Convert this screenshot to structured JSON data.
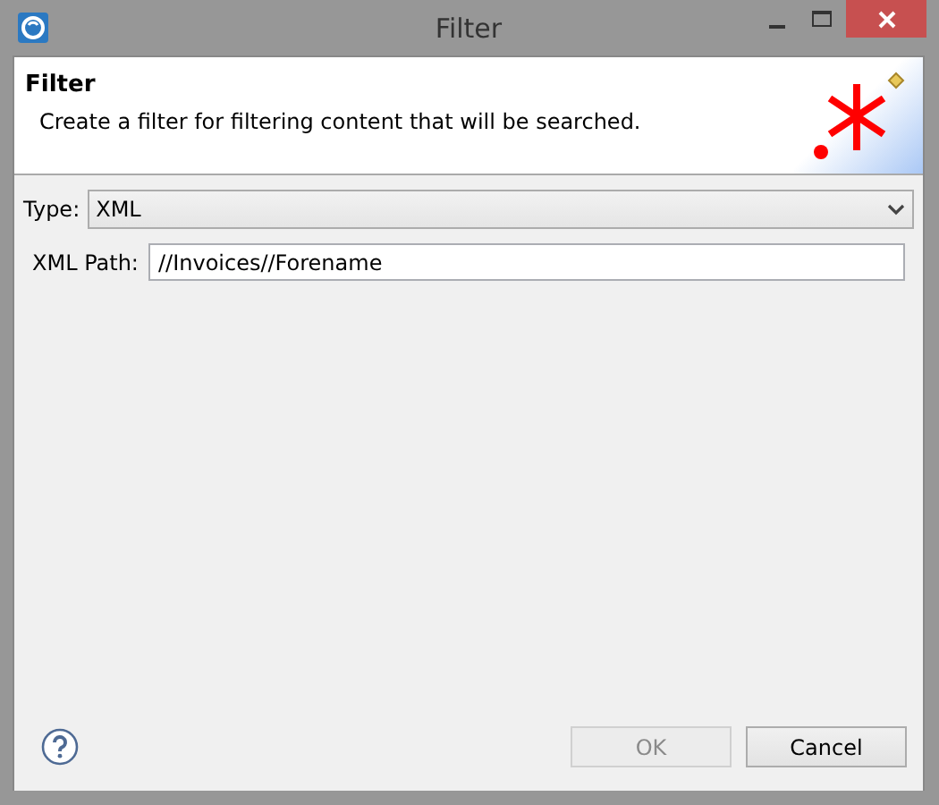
{
  "window": {
    "title": "Filter"
  },
  "header": {
    "title": "Filter",
    "description": "Create a filter for filtering content that will be searched."
  },
  "fields": [
    {
      "kind": "dropdown",
      "label": "Type:",
      "value": "XML"
    },
    {
      "kind": "text",
      "label": "XML Path:",
      "value": "//Invoices//Forename"
    }
  ],
  "buttons": [
    {
      "label": "OK",
      "disabled": true
    },
    {
      "label": "Cancel",
      "disabled": false
    }
  ]
}
